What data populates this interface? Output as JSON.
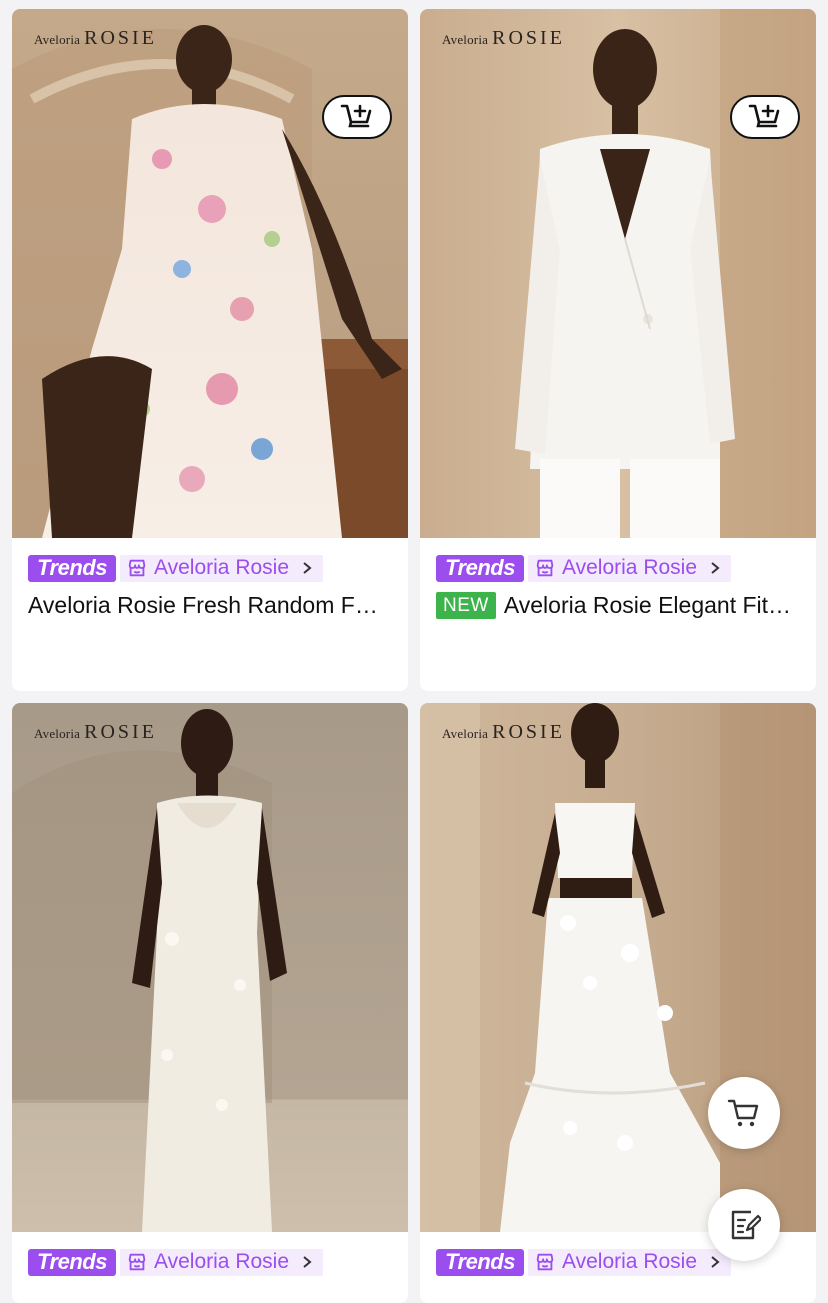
{
  "products": [
    {
      "brand_logo_small": "Aveloria",
      "brand_logo_big": "ROSIE",
      "trends_label": "Trends",
      "store_name": "Aveloria Rosie",
      "badge": "",
      "title": "Aveloria Rosie Fresh Random Floral Print Dress",
      "image": "floral-print-dress"
    },
    {
      "brand_logo_small": "Aveloria",
      "brand_logo_big": "ROSIE",
      "trends_label": "Trends",
      "store_name": "Aveloria Rosie",
      "badge": "NEW",
      "title": "Aveloria Rosie Elegant Fitted Blazer",
      "image": "white-blazer-suit"
    },
    {
      "brand_logo_small": "Aveloria",
      "brand_logo_big": "ROSIE",
      "trends_label": "Trends",
      "store_name": "Aveloria Rosie",
      "badge": "",
      "title": "",
      "image": "white-satin-cowl-dress"
    },
    {
      "brand_logo_small": "Aveloria",
      "brand_logo_big": "ROSIE",
      "trends_label": "Trends",
      "store_name": "Aveloria Rosie",
      "badge": "",
      "title": "",
      "image": "white-crop-top-skirt-set"
    }
  ],
  "icons": {
    "store": "store-icon",
    "chevron": "chevron-right-icon",
    "add_to_cart": "cart-plus-icon",
    "floating_cart": "shopping-cart-icon",
    "floating_edit": "edit-note-icon"
  },
  "colors": {
    "trends_purple": "#9b4dee",
    "store_chip_bg": "#f4ecfd",
    "new_badge_green": "#3cb44b"
  }
}
